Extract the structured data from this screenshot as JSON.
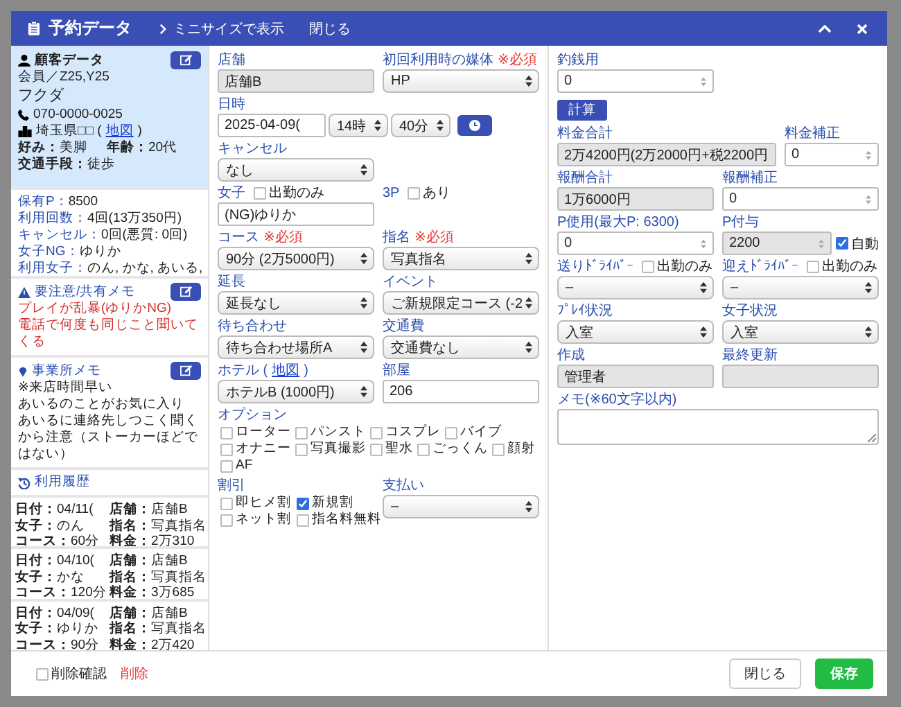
{
  "window": {
    "title": "予約データ",
    "mini_link": "ミニサイズで表示",
    "close_link": "閉じる"
  },
  "customer": {
    "heading": "顧客データ",
    "member": "会員／Z25,Y25",
    "name": "フクダ",
    "phone": "070-0000-0025",
    "address": "埼玉県□□ (",
    "map_link": "地図",
    "address_end": ")",
    "details": [
      {
        "label": "好み：",
        "value": "美脚"
      },
      {
        "label": "年齢：",
        "value": "20代"
      },
      {
        "label": "交通手段：",
        "value": "徒歩"
      }
    ]
  },
  "stats": [
    {
      "label": "保有P：",
      "value": "8500"
    },
    {
      "label": "利用回数：",
      "value": "4回(13万350円)"
    },
    {
      "label": "キャンセル：",
      "value": "0回(悪質: 0回)"
    },
    {
      "label": "女子NG：",
      "value": "ゆりか"
    },
    {
      "label": "利用女子：",
      "value": "のん, かな, あいる,"
    }
  ],
  "notice": {
    "heading": "要注意/共有メモ",
    "lines": [
      "プレイが乱暴(ゆりかNG)",
      "電話で何度も同じこと聞いてくる"
    ]
  },
  "office_memo": {
    "heading": "事業所メモ",
    "lines": [
      "※来店時間早い",
      "あいるのことがお気に入り",
      "あいるに連絡先しつこく聞くから注意（ストーカーほどではない）"
    ]
  },
  "history": {
    "heading": "利用履歴",
    "entries": [
      {
        "items": [
          {
            "label": "日付：",
            "value": "04/11("
          },
          {
            "label": "店舗：",
            "value": "店舗B"
          },
          {
            "label": "女子：",
            "value": "のん"
          },
          {
            "label": "指名：",
            "value": "写真指名"
          },
          {
            "label": "コース：",
            "value": "60分"
          },
          {
            "label": "料金：",
            "value": "2万310"
          }
        ]
      },
      {
        "items": [
          {
            "label": "日付：",
            "value": "04/10("
          },
          {
            "label": "店舗：",
            "value": "店舗B"
          },
          {
            "label": "女子：",
            "value": "かな"
          },
          {
            "label": "指名：",
            "value": "写真指名"
          },
          {
            "label": "コース：",
            "value": "120分"
          },
          {
            "label": "料金：",
            "value": "3万685"
          }
        ]
      },
      {
        "items": [
          {
            "label": "日付：",
            "value": "04/09("
          },
          {
            "label": "店舗：",
            "value": "店舗B"
          },
          {
            "label": "女子：",
            "value": "ゆりか"
          },
          {
            "label": "指名：",
            "value": "写真指名"
          },
          {
            "label": "コース：",
            "value": "90分"
          },
          {
            "label": "料金：",
            "value": "2万420"
          }
        ]
      }
    ]
  },
  "middle": {
    "fields": [
      {
        "label": "店舗",
        "kind": "readonly",
        "value": "店舗B"
      },
      {
        "label": "初回利用時の媒体",
        "required_mark": "※必須",
        "kind": "select",
        "value": "HP"
      },
      {
        "label": "日時",
        "kind": "datetime",
        "date": "2025-04-09(",
        "hour": "14時",
        "minute": "40分"
      },
      {
        "label": "キャンセル",
        "kind": "select",
        "value": "なし"
      },
      {
        "kind": "blank"
      },
      {
        "label": "女子",
        "check": {
          "label": "出勤のみ",
          "checked": false
        },
        "kind": "input",
        "value": "(NG)ゆりか"
      },
      {
        "label": "3P",
        "check": {
          "label": "あり",
          "checked": false
        },
        "kind": "blank"
      },
      {
        "label": "コース",
        "required_mark": "※必須",
        "kind": "select",
        "value": "90分 (2万5000円)"
      },
      {
        "label": "指名",
        "required_mark": "※必須",
        "kind": "select",
        "value": "写真指名"
      },
      {
        "label": "延長",
        "kind": "select",
        "value": "延長なし"
      },
      {
        "label": "イベント",
        "kind": "select",
        "value": "ご新規限定コース (-2"
      },
      {
        "label": "待ち合わせ",
        "kind": "select",
        "value": "待ち合わせ場所A"
      },
      {
        "label": "交通費",
        "kind": "select",
        "value": "交通費なし"
      },
      {
        "label": "ホテル (",
        "link": "地図",
        "label_end": ")",
        "kind": "select",
        "value": "ホテルB (1000円)"
      },
      {
        "label": "部屋",
        "kind": "input",
        "value": "206"
      },
      {
        "label": "オプション",
        "kind": "options",
        "options": [
          {
            "label": "ローター",
            "checked": false
          },
          {
            "label": "パンスト",
            "checked": false
          },
          {
            "label": "コスプレ",
            "checked": false
          },
          {
            "label": "バイブ",
            "checked": false
          },
          {
            "label": "オナニー",
            "checked": false
          },
          {
            "label": "写真撮影",
            "checked": false
          },
          {
            "label": "聖水",
            "checked": false
          },
          {
            "label": "ごっくん",
            "checked": false
          },
          {
            "label": "顔射",
            "checked": false
          },
          {
            "label": "AF",
            "checked": false
          }
        ]
      },
      {
        "label": "割引",
        "kind": "checks",
        "options": [
          {
            "label": "即ヒメ割",
            "checked": false
          },
          {
            "label": "新規割",
            "checked": true
          },
          {
            "label": "ネット割",
            "checked": false
          },
          {
            "label": "指名料無料",
            "checked": false
          }
        ]
      },
      {
        "label": "支払い",
        "kind": "select",
        "value": "–"
      }
    ]
  },
  "right": {
    "fields": [
      {
        "label": "釣銭用",
        "kind": "number",
        "value": "0"
      },
      {
        "kind": "blank"
      },
      {
        "label": "計算",
        "kind": "button"
      },
      {
        "label": "料金合計",
        "kind": "total",
        "value": "2万4200円(2万2000円+税2200円"
      },
      {
        "label": "料金補正",
        "kind": "number",
        "value": "0"
      },
      {
        "label": "報酬合計",
        "kind": "readonly",
        "value": "1万6000円"
      },
      {
        "label": "報酬補正",
        "kind": "number",
        "value": "0"
      },
      {
        "label": "P使用(最大P: 6300)",
        "kind": "number",
        "value": "0"
      },
      {
        "label": "P付与",
        "kind": "points",
        "value": "2200",
        "auto": {
          "label": "自動",
          "checked": true
        }
      },
      {
        "label": "送りﾄﾞﾗｲﾊﾞｰ",
        "check": {
          "label": "出勤のみ",
          "checked": false
        },
        "kind": "select",
        "value": "–"
      },
      {
        "label": "迎えﾄﾞﾗｲﾊﾞｰ",
        "check": {
          "label": "出勤のみ",
          "checked": false
        },
        "kind": "select",
        "value": "–"
      },
      {
        "label": "ﾌﾟﾚｲ状況",
        "kind": "select",
        "value": "入室"
      },
      {
        "label": "女子状況",
        "kind": "select",
        "value": "入室"
      },
      {
        "label": "作成",
        "kind": "readonly",
        "value": "管理者"
      },
      {
        "label": "最終更新",
        "kind": "readonly"
      },
      {
        "label": "メモ(※60文字以内)",
        "kind": "textarea"
      }
    ]
  },
  "footer": {
    "delete_confirm": {
      "label": "削除確認",
      "checked": false
    },
    "delete_link": "削除",
    "close_button": "閉じる",
    "save_button": "保存"
  }
}
